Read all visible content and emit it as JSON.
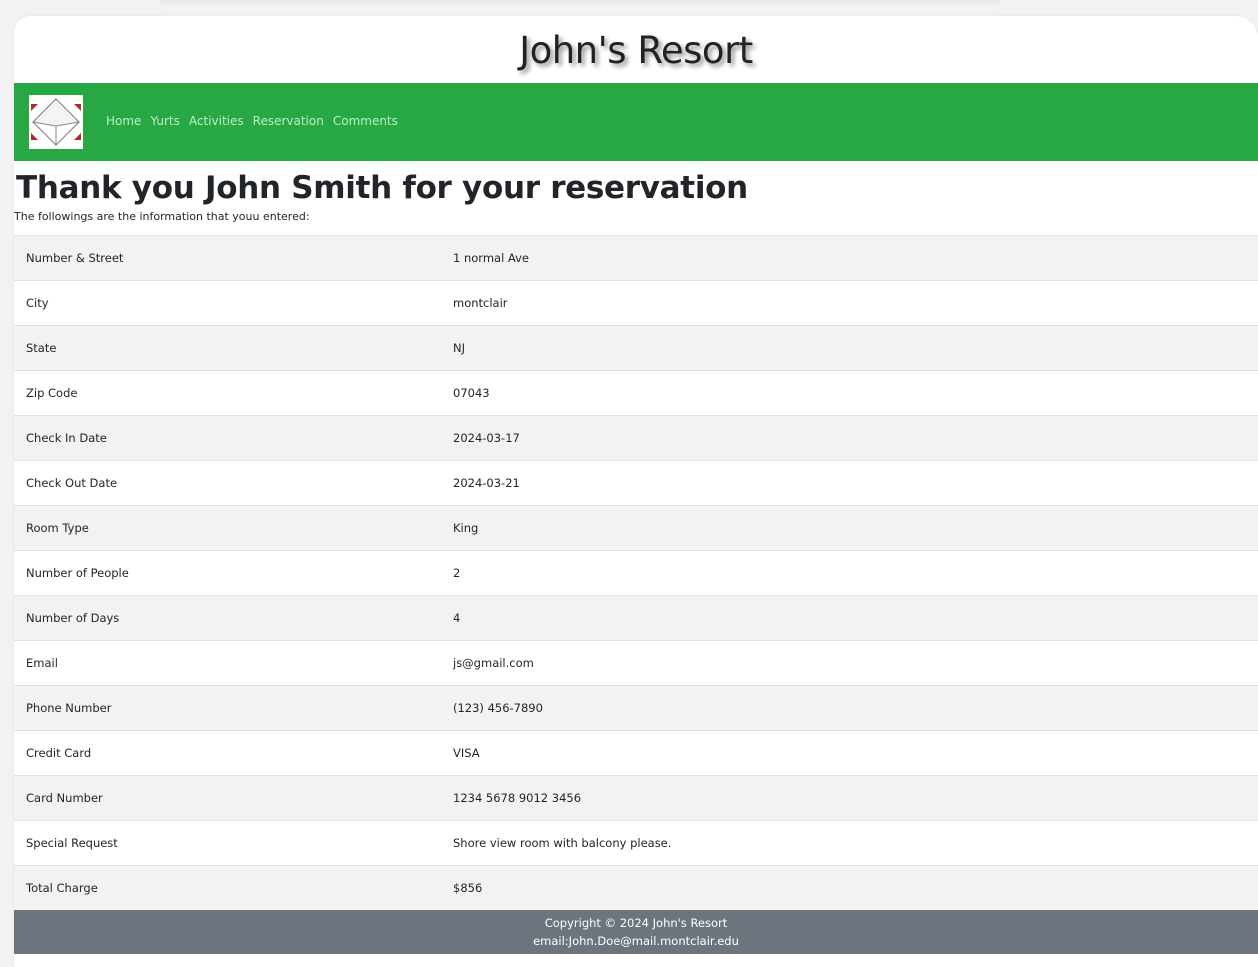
{
  "site": {
    "title": "John's Resort"
  },
  "nav": {
    "logo_icon": "cube-logo-icon",
    "items": [
      "Home",
      "Yurts",
      "Activities",
      "Reservation",
      "Comments"
    ]
  },
  "main": {
    "heading": "Thank you John Smith for your reservation",
    "subtext": "The followings are the information that youu entered:",
    "rows": [
      {
        "label": "Number & Street",
        "value": "1 normal Ave"
      },
      {
        "label": "City",
        "value": "montclair"
      },
      {
        "label": "State",
        "value": "NJ"
      },
      {
        "label": "Zip Code",
        "value": "07043"
      },
      {
        "label": "Check In Date",
        "value": "2024-03-17"
      },
      {
        "label": "Check Out Date",
        "value": "2024-03-21"
      },
      {
        "label": "Room Type",
        "value": "King"
      },
      {
        "label": "Number of People",
        "value": "2"
      },
      {
        "label": "Number of Days",
        "value": "4"
      },
      {
        "label": "Email",
        "value": "js@gmail.com"
      },
      {
        "label": "Phone Number",
        "value": "(123) 456-7890"
      },
      {
        "label": "Credit Card",
        "value": "VISA"
      },
      {
        "label": "Card Number",
        "value": "1234 5678 9012 3456"
      },
      {
        "label": "Special Request",
        "value": "Shore view room with balcony please."
      },
      {
        "label": "Total Charge",
        "value": "$856"
      }
    ]
  },
  "footer": {
    "copyright": "Copyright © 2024 John's Resort",
    "email": "email:John.Doe@mail.montclair.edu"
  },
  "colors": {
    "navbar": "#28a745",
    "nav_link": "#b9f0c6",
    "footer": "#6c757d",
    "stripe": "#f2f2f2"
  }
}
